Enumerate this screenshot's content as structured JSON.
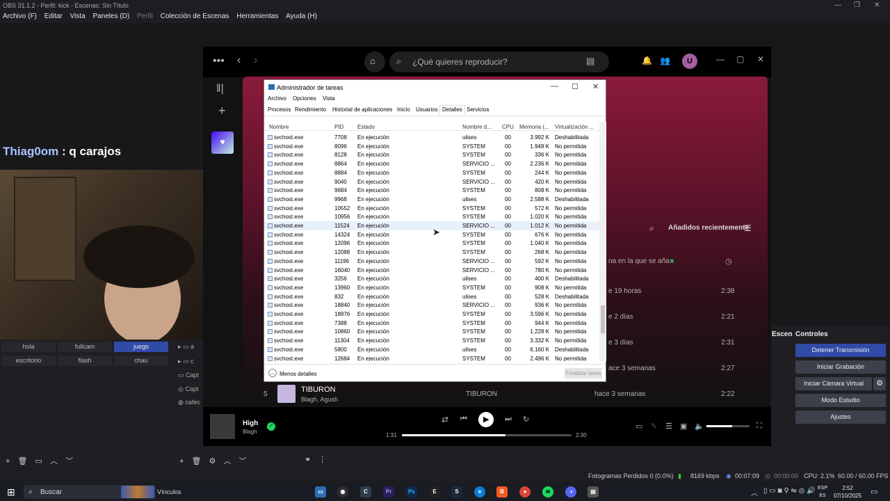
{
  "obs": {
    "title": "OBS 31.1.2 - Perfil: kick - Escenas: Sin Título",
    "menu": [
      "Archivo (F)",
      "Editar",
      "Vista",
      "Paneles (D)",
      "Perfil",
      "Colección de Escenas",
      "Herramientas",
      "Ayuda (H)"
    ],
    "chat": {
      "user": "Thiag0om",
      "sep": " : ",
      "message": "q carajos"
    },
    "scenes": [
      "hola",
      "fullcam",
      "juego",
      "escritorio",
      "flash",
      "chau"
    ],
    "active_scene": "juego",
    "sources": [
      "a",
      "c",
      "Capt",
      "Capt",
      "cafec"
    ],
    "escena_header": "Escena",
    "controls_header": "Controles",
    "controls": {
      "stop_stream": "Detener Transmisión",
      "start_rec": "Iniciar Grabación",
      "virtual_cam": "Iniciar Cámara Virtual",
      "studio": "Modo Estudio",
      "settings": "Ajustes"
    },
    "status": {
      "dropped": "Fotogramas Perdidos 0 (0.0%)",
      "bitrate": "8169 kbps",
      "stream_time": "00:07:09",
      "rec_time": "00:00:00",
      "cpu": "CPU: 2.1%",
      "fps": "60.00 / 60.00 FPS"
    },
    "accent": "#2f4ba7"
  },
  "spotify": {
    "search_placeholder": "¿Qué quieres reproducir?",
    "avatar": "U",
    "recent_label": "Añadidos recientemente",
    "col_added": "na en la que se aña...",
    "rows": [
      {
        "when": "e 19 horas",
        "dur": "2:38"
      },
      {
        "when": "e 2 días",
        "dur": "2:21"
      },
      {
        "when": "e 3 días",
        "dur": "2:31"
      },
      {
        "when": "ace 3 semanas",
        "dur": "2:27"
      }
    ],
    "track5": {
      "num": "5",
      "title": "TIBURON",
      "artist": "Blagh, Agush",
      "album": "TIBURON",
      "added": "hace 3 semanas",
      "dur": "2:22"
    },
    "now_playing": {
      "title": "High",
      "artist": "Blagh",
      "elapsed": "1:31",
      "total": "2:30",
      "progress": 0.61,
      "volume": 0.6
    },
    "accent": "#1ed760"
  },
  "taskmgr": {
    "title": "Administrador de tareas",
    "menu": [
      "Archivo",
      "Opciones",
      "Vista"
    ],
    "tabs": [
      "Procesos",
      "Rendimiento",
      "Historial de aplicaciones",
      "Inicio",
      "Usuarios",
      "Detalles",
      "Servicios"
    ],
    "active_tab": "Detalles",
    "columns": [
      "Nombre",
      "PID",
      "Estado",
      "Nombre d...",
      "CPU",
      "Memoria (...",
      "Virtualización ..."
    ],
    "rows": [
      [
        "svchost.exe",
        "7708",
        "En ejecución",
        "ulises",
        "00",
        "3.992 K",
        "Deshabilitada"
      ],
      [
        "svchost.exe",
        "8096",
        "En ejecución",
        "SYSTEM",
        "00",
        "1.948 K",
        "No permitida"
      ],
      [
        "svchost.exe",
        "8128",
        "En ejecución",
        "SYSTEM",
        "00",
        "336 K",
        "No permitida"
      ],
      [
        "svchost.exe",
        "8864",
        "En ejecución",
        "SERVICIO ...",
        "00",
        "2.236 K",
        "No permitida"
      ],
      [
        "svchost.exe",
        "8884",
        "En ejecución",
        "SYSTEM",
        "00",
        "244 K",
        "No permitida"
      ],
      [
        "svchost.exe",
        "9040",
        "En ejecución",
        "SERVICIO ...",
        "00",
        "420 K",
        "No permitida"
      ],
      [
        "svchost.exe",
        "9684",
        "En ejecución",
        "SYSTEM",
        "00",
        "808 K",
        "No permitida"
      ],
      [
        "svchost.exe",
        "9968",
        "En ejecución",
        "ulises",
        "00",
        "2.588 K",
        "Deshabilitada"
      ],
      [
        "svchost.exe",
        "10552",
        "En ejecución",
        "SYSTEM",
        "00",
        "572 K",
        "No permitida"
      ],
      [
        "svchost.exe",
        "10956",
        "En ejecución",
        "SYSTEM",
        "00",
        "1.020 K",
        "No permitida"
      ],
      [
        "svchost.exe",
        "11524",
        "En ejecución",
        "SERVICIO ...",
        "00",
        "1.012 K",
        "No permitida"
      ],
      [
        "svchost.exe",
        "14324",
        "En ejecución",
        "SYSTEM",
        "00",
        "676 K",
        "No permitida"
      ],
      [
        "svchost.exe",
        "12096",
        "En ejecución",
        "SYSTEM",
        "00",
        "1.040 K",
        "No permitida"
      ],
      [
        "svchost.exe",
        "12088",
        "En ejecución",
        "SYSTEM",
        "00",
        "268 K",
        "No permitida"
      ],
      [
        "svchost.exe",
        "11196",
        "En ejecución",
        "SERVICIO ...",
        "00",
        "592 K",
        "No permitida"
      ],
      [
        "svchost.exe",
        "16040",
        "En ejecución",
        "SERVICIO ...",
        "00",
        "780 K",
        "No permitida"
      ],
      [
        "svchost.exe",
        "3256",
        "En ejecución",
        "ulises",
        "00",
        "400 K",
        "Deshabilitada"
      ],
      [
        "svchost.exe",
        "13960",
        "En ejecución",
        "SYSTEM",
        "00",
        "908 K",
        "No permitida"
      ],
      [
        "svchost.exe",
        "832",
        "En ejecución",
        "ulises",
        "00",
        "528 K",
        "Deshabilitada"
      ],
      [
        "svchost.exe",
        "18840",
        "En ejecución",
        "SERVICIO ...",
        "00",
        "936 K",
        "No permitida"
      ],
      [
        "svchost.exe",
        "18976",
        "En ejecución",
        "SYSTEM",
        "00",
        "3.596 K",
        "No permitida"
      ],
      [
        "svchost.exe",
        "7388",
        "En ejecución",
        "SYSTEM",
        "00",
        "944 K",
        "No permitida"
      ],
      [
        "svchost.exe",
        "10860",
        "En ejecución",
        "SYSTEM",
        "00",
        "1.228 K",
        "No permitida"
      ],
      [
        "svchost.exe",
        "11304",
        "En ejecución",
        "SYSTEM",
        "00",
        "3.332 K",
        "No permitida"
      ],
      [
        "svchost.exe",
        "5800",
        "En ejecución",
        "ulises",
        "00",
        "6.160 K",
        "Deshabilitada"
      ],
      [
        "svchost.exe",
        "12684",
        "En ejecución",
        "SYSTEM",
        "00",
        "2.496 K",
        "No permitida"
      ]
    ],
    "highlight_index": 10,
    "less_details": "Menos detalles",
    "end_task": "Finalizar tarea"
  },
  "taskbar": {
    "search": "Buscar",
    "widget_label": "Vínculos",
    "lang": [
      "ESP",
      "ES"
    ],
    "time": "2:52",
    "date": "07/10/2025"
  }
}
